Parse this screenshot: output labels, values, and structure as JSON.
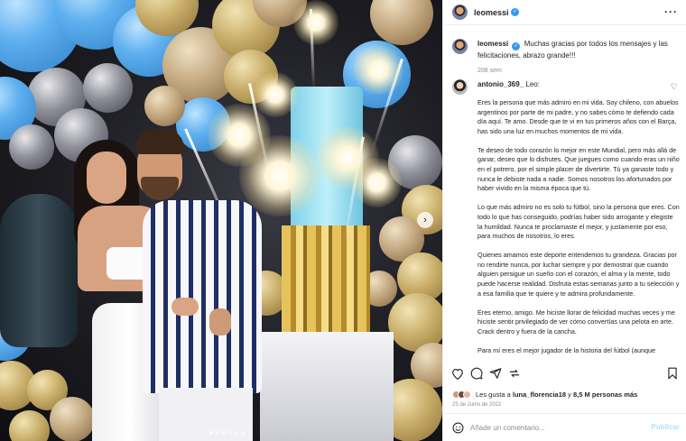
{
  "post": {
    "username": "leomessi",
    "caption_text": "Muchas gracias por todos los mensajes y las felicitaciones, abrazo grande!!!",
    "caption_time": "208 sem"
  },
  "comment": {
    "username": "antonio_369_",
    "intro": "Leo:",
    "paragraphs": [
      "Eres la persona que más admiro en mi vida. Soy chileno, con abuelos argentinos por parte de mi padre, y no sabes cómo te defiendo cada día aquí. Te amo. Desde que te vi en tus primeros años con el Barça, has sido una luz en muchos momentos de mi vida.",
      "Te deseo de todo corazón lo mejor en este Mundial, pero más allá de ganar, deseo que lo disfrutes. Que juegues como cuando eras un niño en el potrero, por el simple placer de divertirte. Tú ya ganaste todo y nunca le debiste nada a nadie. Somos nosotros los afortunados por haber vivido en la misma época que tú.",
      "Lo que más admiro no es solo tu fútbol, sino la persona que eres. Con todo lo que has conseguido, podrías haber sido arrogante y elegiste la humildad. Nunca te proclamaste el mejor, y justamente por eso, para muchos de nosotros, lo eres.",
      "Quienes amamos este deporte entendemos tu grandeza. Gracias por no rendirte nunca, por luchar siempre y por demostrar que cuando alguien persigue un sueño con el corazón, el alma y la mente, todo puede hacerse realidad. Disfruta estas semanas junto a tu selección y a esa familia que te quiere y te admira profundamente.",
      "Eres eterno, amigo. Me hiciste llorar de felicidad muchas veces y me hiciste sentir privilegiado de ver cómo convertías una pelota en arte. Crack dentro y fuera de la cancha.",
      "Para mí eres el mejor jugador de la historia del fútbol (aunque"
    ]
  },
  "likes": {
    "prefix": "Les gusta a",
    "user": "luna_florencia18",
    "connector": "y",
    "count": "8,5 M personas más"
  },
  "date": "25 de Junio de 2022",
  "add_comment": {
    "placeholder": "Añade un comentario...",
    "publish_label": "Publicar"
  },
  "carousel": {
    "slides": 6,
    "active": 1
  },
  "icons": {
    "more": "more-options-icon",
    "verified": "verified-badge-icon",
    "like": "heart-icon",
    "comment": "comment-icon",
    "share": "share-icon",
    "save": "bookmark-icon",
    "emoji": "emoji-icon",
    "next": "chevron-right-icon"
  },
  "colors": {
    "verified": "#3897f0",
    "publish": "#b2dffc",
    "muted": "#8e8e8e"
  }
}
